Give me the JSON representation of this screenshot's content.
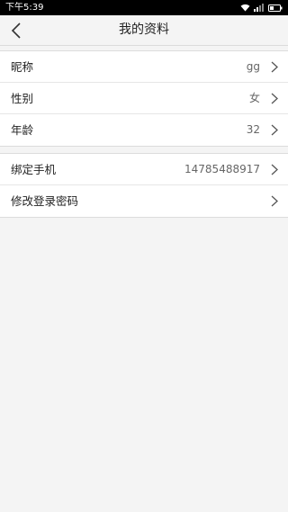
{
  "status_bar": {
    "time": "下午5:39",
    "icons": [
      "wifi-icon",
      "signal-icon",
      "battery-icon"
    ]
  },
  "header": {
    "title": "我的资料",
    "back_icon": "chevron-left-icon"
  },
  "profile_items": [
    {
      "label": "昵称",
      "value": "gg"
    },
    {
      "label": "性别",
      "value": "女"
    },
    {
      "label": "年龄",
      "value": "32"
    }
  ],
  "account_items": [
    {
      "label": "绑定手机",
      "value": "14785488917"
    },
    {
      "label": "修改登录密码",
      "value": ""
    }
  ],
  "colors": {
    "background": "#f4f4f4",
    "row_background": "#ffffff",
    "text_primary": "#222222",
    "text_secondary": "#666666"
  }
}
